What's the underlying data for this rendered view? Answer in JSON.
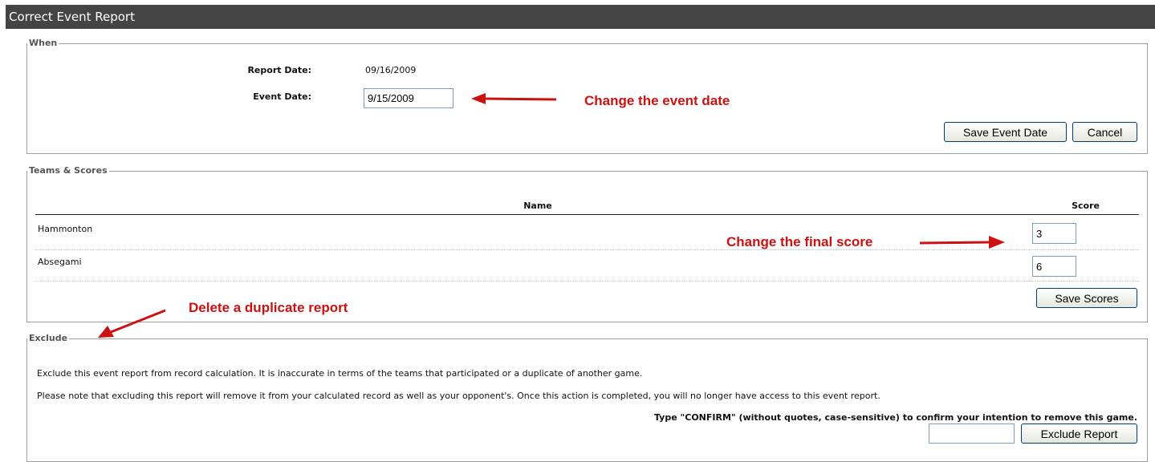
{
  "window": {
    "title": "Correct Event Report"
  },
  "when": {
    "legend": "When",
    "report_date_label": "Report Date:",
    "report_date_value": "09/16/2009",
    "event_date_label": "Event Date:",
    "event_date_value": "9/15/2009",
    "save_button": "Save Event Date",
    "cancel_button": "Cancel"
  },
  "teams": {
    "legend": "Teams & Scores",
    "header_name": "Name",
    "header_score": "Score",
    "rows": [
      {
        "name": "Hammonton",
        "score": "3"
      },
      {
        "name": "Absegami",
        "score": "6"
      }
    ],
    "save_button": "Save Scores"
  },
  "exclude": {
    "legend": "Exclude",
    "description": "Exclude this event report from record calculation. It is inaccurate in terms of the teams that participated or a duplicate of another game.",
    "note": "Please note that excluding this report will remove it from your calculated record as well as your opponent's. Once this action is completed, you will no longer have access to this event report.",
    "confirm_text": "Type \"CONFIRM\" (without quotes, case-sensitive) to confirm your intention to remove this game.",
    "confirm_value": "",
    "exclude_button": "Exclude Report"
  },
  "annotations": {
    "event_date": "Change the event date",
    "final_score": "Change the final score",
    "duplicate": "Delete a duplicate report",
    "color": "#cc1111"
  }
}
